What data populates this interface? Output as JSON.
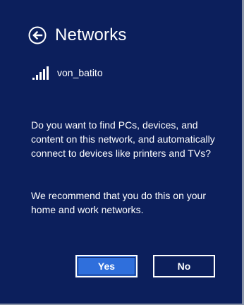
{
  "header": {
    "title": "Networks",
    "back_icon": "back-arrow-icon"
  },
  "network": {
    "name": "von_batito",
    "icon": "wifi-signal-icon"
  },
  "message": {
    "question": "Do you want to find PCs, devices, and content on this network, and automatically connect to devices like printers and TVs?",
    "recommendation": "We recommend that you do this on your home and work networks."
  },
  "buttons": {
    "yes_label": "Yes",
    "no_label": "No"
  },
  "colors": {
    "background": "#0c1f5c",
    "accent": "#2f6fdc",
    "text": "#ffffff"
  }
}
